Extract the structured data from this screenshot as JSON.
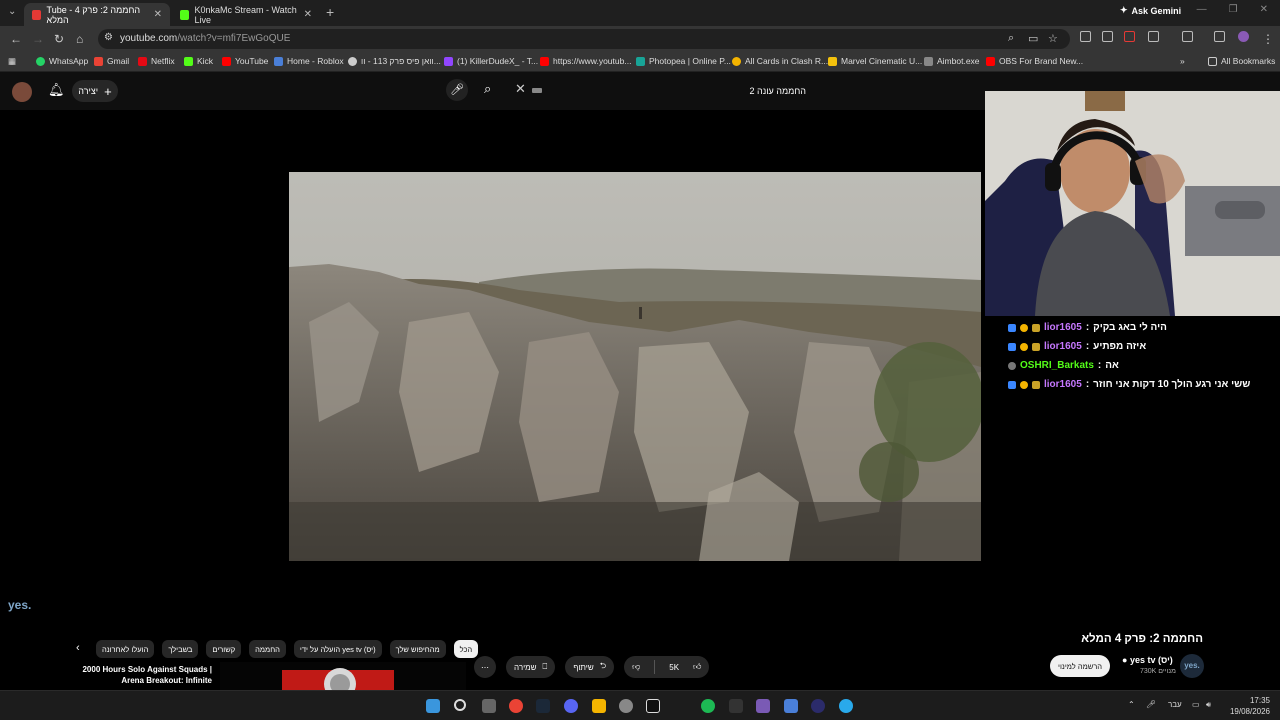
{
  "browser": {
    "tabs": [
      {
        "label": "Tube - החממה 2: פרק 4 המלא",
        "color": "#e53935"
      },
      {
        "label": "K0nkaMc Stream - Watch Live",
        "color": "#53fc18"
      }
    ],
    "ask_gemini": "Ask Gemini",
    "url": "youtube.com",
    "url_path": "/watch?v=mfi7EwGoQUE",
    "bookmarks": [
      {
        "label": "WhatsApp",
        "color": "#25d366"
      },
      {
        "label": "Gmail",
        "color": "#ea4335"
      },
      {
        "label": "Netflix",
        "color": "#e50914"
      },
      {
        "label": "Kick",
        "color": "#53fc18"
      },
      {
        "label": "YouTube",
        "color": "#ff0000"
      },
      {
        "label": "Home - Roblox",
        "color": "#4a7fd8"
      },
      {
        "label": "וואן פיס פרק 113 - וו...",
        "color": "#cccccc"
      },
      {
        "label": "(1) KillerDudeX_ - T...",
        "color": "#9146ff"
      },
      {
        "label": "https://www.youtub...",
        "color": "#ff0000"
      },
      {
        "label": "Photopea | Online P...",
        "color": "#18a497"
      },
      {
        "label": "All Cards in Clash R...",
        "color": "#f4b400"
      },
      {
        "label": "Marvel Cinematic U...",
        "color": "#f4c20d"
      },
      {
        "label": "Aimbot.exe",
        "color": "#888888"
      },
      {
        "label": "OBS For Brand New...",
        "color": "#ff0000"
      }
    ],
    "all_bookmarks": "All Bookmarks"
  },
  "youtube": {
    "create_label": "יצירה",
    "search_value": "החממה עונה 2"
  },
  "video": {
    "watermark": "yes."
  },
  "chat": [
    {
      "user": "lior1605",
      "message": "היה לי באג בקיק"
    },
    {
      "user": "lior1605",
      "message": "איזה מפתיע"
    },
    {
      "user": "OSHRI_Barkats",
      "message": "אה"
    },
    {
      "user": "lior1605",
      "message": "ששי אני רגע הולך 10 דקות אני חוזר"
    }
  ],
  "watch": {
    "title": "החממה 2: פרק 4 המלא",
    "channel_name": "yes tv (יס)",
    "channel_avatar": "yes.",
    "subscribers": "730K מנויים",
    "subscribe_label": "הרשמה למינוי",
    "like_count": "5K",
    "share_label": "שיתוף",
    "save_label": "שמירה",
    "more_icon": "⋯",
    "chips": [
      "הכל",
      "מהחיפוש שלך",
      "הועלה על ידי yes tv (יס)",
      "החממה",
      "קשורים",
      "בשבילך",
      "הועלו לאחרונה"
    ],
    "related_title": "2000 Hours Solo Against Squads | Arena Breakout: Infinite"
  },
  "taskbar": {
    "lang": "עבר",
    "time": "17:35",
    "date": "19/08/2026"
  }
}
